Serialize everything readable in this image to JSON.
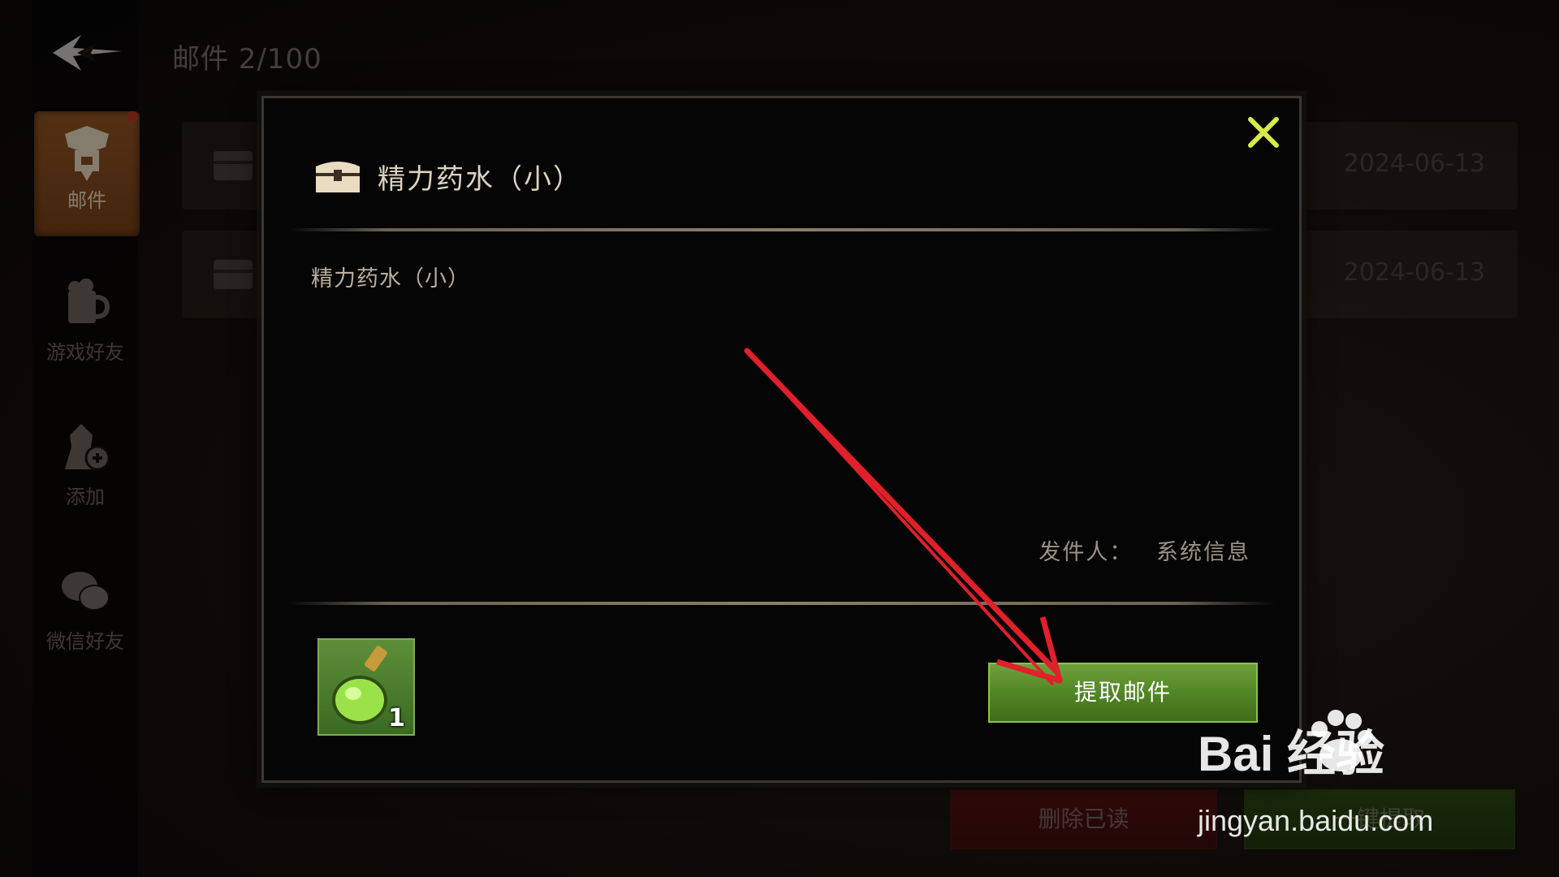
{
  "header": {
    "title": "邮件 2/100"
  },
  "sidebar": {
    "items": [
      {
        "label": "邮件"
      },
      {
        "label": "游戏好友"
      },
      {
        "label": "添加"
      },
      {
        "label": "微信好友"
      }
    ]
  },
  "mail_list": [
    {
      "date": "2024-06-13"
    },
    {
      "date": "2024-06-13"
    }
  ],
  "actions": {
    "delete_read": "删除已读",
    "claim_all": "一键提取"
  },
  "modal": {
    "title": "精力药水（小）",
    "body": "精力药水（小）",
    "sender_label": "发件人：",
    "sender_name": "系统信息",
    "attachment": {
      "icon": "green-potion-icon",
      "count": "1"
    },
    "claim_button": "提取邮件"
  },
  "watermark": {
    "brand": "Bai  经验",
    "url": "jingyan.baidu.com"
  },
  "colors": {
    "accent_green": "#5a9a2e",
    "annotation_red": "#e0202a",
    "active_tab": "#8a4e20"
  }
}
